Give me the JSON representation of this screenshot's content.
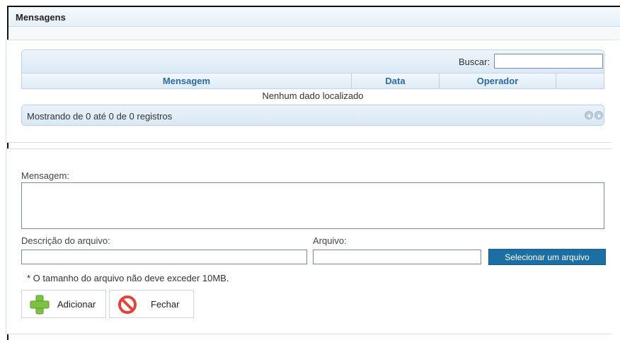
{
  "header": {
    "title": "Mensagens"
  },
  "search": {
    "label": "Buscar:",
    "value": ""
  },
  "table": {
    "columns": [
      "Mensagem",
      "Data",
      "Operador",
      ""
    ],
    "empty_text": "Nenhum dado localizado",
    "info": "Mostrando de 0 até 0 de 0 registros"
  },
  "form": {
    "message_label": "Mensagem:",
    "message_value": "",
    "file_desc_label": "Descrição do arquivo:",
    "file_desc_value": "",
    "file_label": "Arquivo:",
    "file_value": "",
    "select_file_button": "Selecionar um arquivo",
    "size_note": "* O tamanho do arquivo não deve exceder 10MB."
  },
  "actions": {
    "add_label": "Adicionar",
    "close_label": "Fechar"
  },
  "colors": {
    "accent": "#1c6fa3",
    "header_text": "#2a6aa0",
    "add_icon": "#7cc242",
    "close_icon": "#e0443a"
  },
  "icons": {
    "add": "plus-icon",
    "close": "ban-icon",
    "prev": "pager-prev-icon",
    "next": "pager-next-icon"
  }
}
